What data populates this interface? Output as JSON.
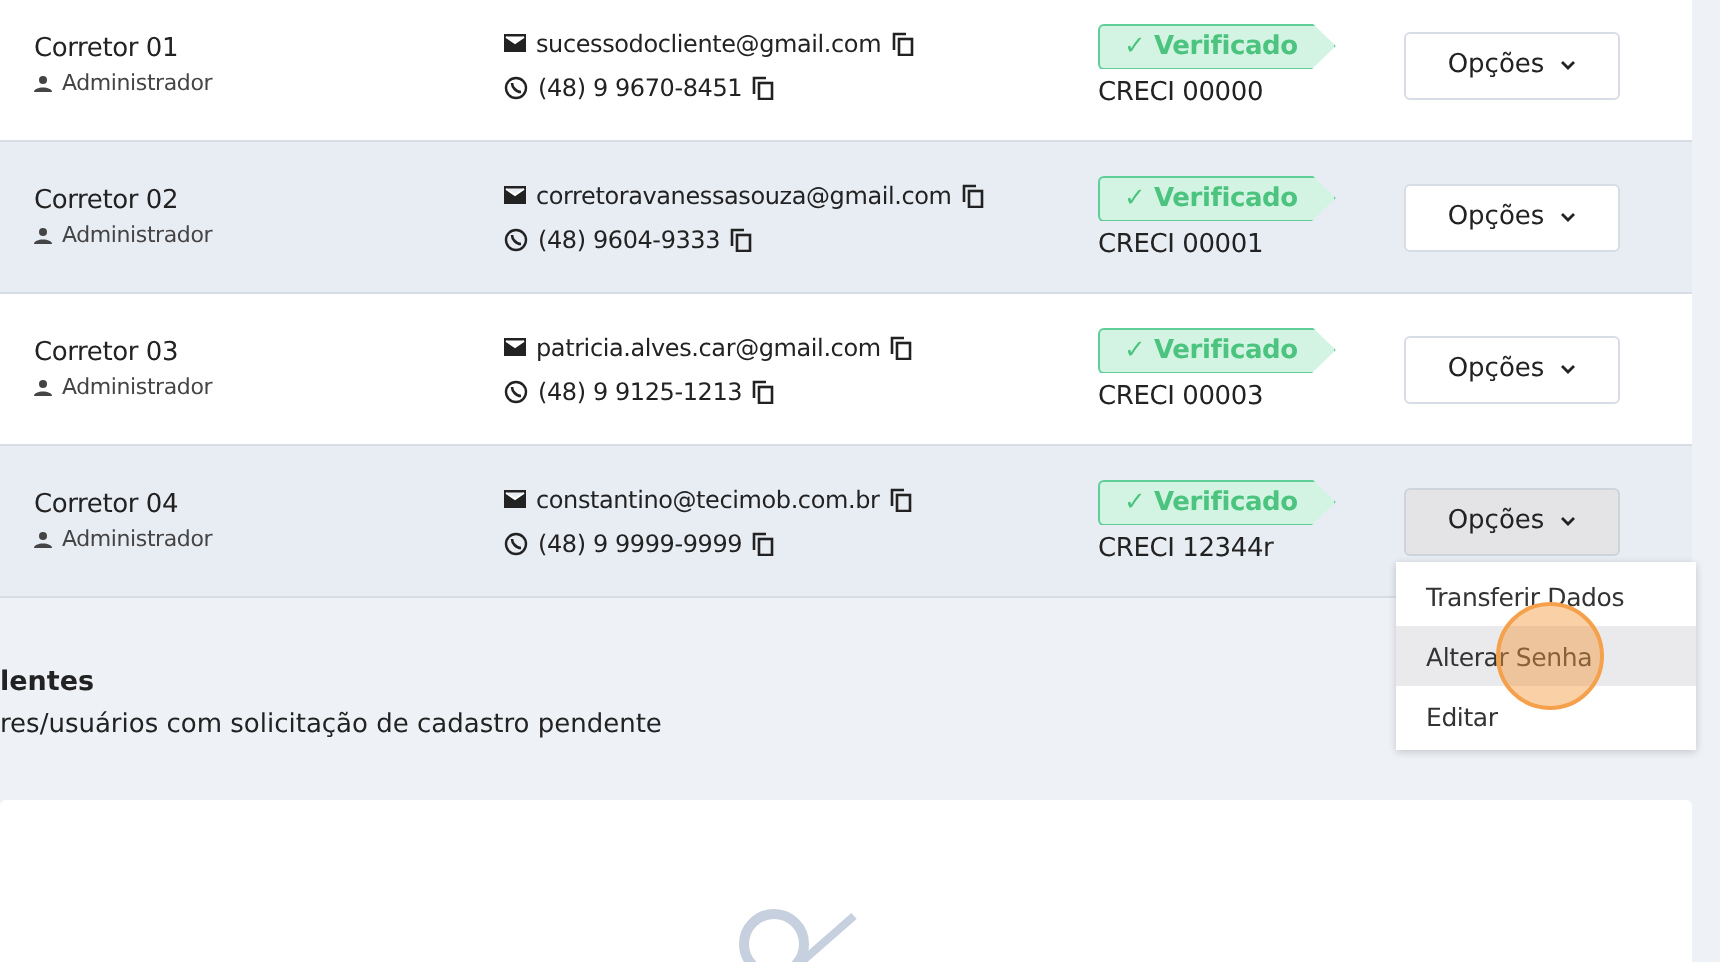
{
  "rows": [
    {
      "name": "Corretor 01",
      "role": "Administrador",
      "email": "sucessodocliente@gmail.com",
      "phone": "(48) 9 9670-8451",
      "badge": "✓ Verificado",
      "creci": "CRECI 00000",
      "button": "Opções",
      "open": false
    },
    {
      "name": "Corretor 02",
      "role": "Administrador",
      "email": "corretoravanessasouza@gmail.com",
      "phone": "(48) 9604-9333",
      "badge": "✓ Verificado",
      "creci": "CRECI 00001",
      "button": "Opções",
      "open": false
    },
    {
      "name": "Corretor 03",
      "role": "Administrador",
      "email": "patricia.alves.car@gmail.com",
      "phone": "(48) 9 9125-1213",
      "badge": "✓ Verificado",
      "creci": "CRECI 00003",
      "button": "Opções",
      "open": false
    },
    {
      "name": "Corretor 04",
      "role": "Administrador",
      "email": "constantino@tecimob.com.br",
      "phone": "(48) 9 9999-9999",
      "badge": "✓ Verificado",
      "creci": "CRECI 12344r",
      "button": "Opções",
      "open": true
    }
  ],
  "menu": [
    {
      "label": "Transferir Dados",
      "selected": false
    },
    {
      "label": "Alterar Senha",
      "selected": true
    },
    {
      "label": "Editar",
      "selected": false
    }
  ],
  "pending": {
    "title": "lentes",
    "text": "res/usuários com solicitação de cadastro pendente"
  }
}
